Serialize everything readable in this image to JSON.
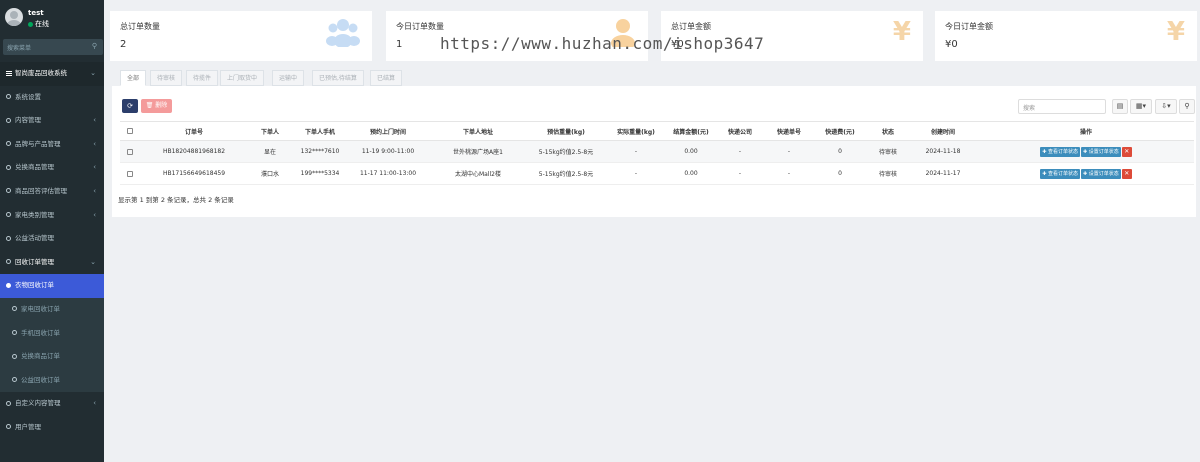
{
  "user": {
    "name": "test",
    "status": "在线"
  },
  "sidebar": {
    "search_placeholder": "搜索菜单",
    "items": [
      {
        "label": "智尚废品回收系统",
        "type": "top",
        "arrow": "⌄"
      },
      {
        "label": "系统设置",
        "type": "item",
        "arrow": ""
      },
      {
        "label": "内容管理",
        "type": "item",
        "arrow": "‹"
      },
      {
        "label": "品牌与产品管理",
        "type": "item",
        "arrow": "‹"
      },
      {
        "label": "兑换商品管理",
        "type": "item",
        "arrow": "‹"
      },
      {
        "label": "商品回答评估管理",
        "type": "item",
        "arrow": "‹"
      },
      {
        "label": "家电类别管理",
        "type": "item",
        "arrow": "‹"
      },
      {
        "label": "公益活动管理",
        "type": "item",
        "arrow": ""
      },
      {
        "label": "回收订单管理",
        "type": "open",
        "arrow": "⌄"
      },
      {
        "label": "衣物回收订单",
        "type": "active",
        "arrow": ""
      },
      {
        "label": "家电回收订单",
        "type": "sub",
        "arrow": ""
      },
      {
        "label": "手机回收订单",
        "type": "sub",
        "arrow": ""
      },
      {
        "label": "兑换商品订单",
        "type": "sub",
        "arrow": ""
      },
      {
        "label": "公益回收订单",
        "type": "sub",
        "arrow": ""
      },
      {
        "label": "自定义内容管理",
        "type": "item",
        "arrow": "‹"
      },
      {
        "label": "用户管理",
        "type": "item",
        "arrow": ""
      }
    ]
  },
  "stats": [
    {
      "label": "总订单数量",
      "value": "2",
      "icon": "users-icon"
    },
    {
      "label": "今日订单数量",
      "value": "1",
      "icon": "user-icon"
    },
    {
      "label": "总订单金额",
      "value": "¥0",
      "icon": "yen-icon"
    },
    {
      "label": "今日订单金额",
      "value": "¥0",
      "icon": "yen-icon"
    }
  ],
  "tabs": [
    "全部",
    "待审核",
    "待揽件",
    "上门取货中",
    "运输中",
    "已预估,待结算",
    "已结算"
  ],
  "toolbar": {
    "delete_label": "删除",
    "search_placeholder": "搜索"
  },
  "table": {
    "headers": [
      "订单号",
      "下单人",
      "下单人手机",
      "预约上门时间",
      "下单人地址",
      "预估重量(kg)",
      "实际重量(kg)",
      "结算金额(元)",
      "快递公司",
      "快递单号",
      "快递费(元)",
      "状态",
      "创建时间",
      "操作"
    ],
    "rows": [
      [
        "HB18204881968182",
        "显在",
        "132****7610",
        "11-19 9:00-11:00",
        "世外桃源广场A座1",
        "5-15kg约值2.5-8元",
        "-",
        "0.00",
        "-",
        "-",
        "0",
        "待审核",
        "2024-11-18"
      ],
      [
        "HB17156649618459",
        "濮口水",
        "199****5334",
        "11-17 11:00-13:00",
        "太湖中心Mall2楼",
        "5-15kg约值2.5-8元",
        "-",
        "0.00",
        "-",
        "-",
        "0",
        "待审核",
        "2024-11-17"
      ]
    ],
    "op_view": "✚ 查看订单状态",
    "op_set": "✚ 设置订单状态",
    "footer": "显示第 1 到第 2 条记录，总共 2 条记录"
  },
  "watermark": "https://www.huzhan.com/ishop3647"
}
